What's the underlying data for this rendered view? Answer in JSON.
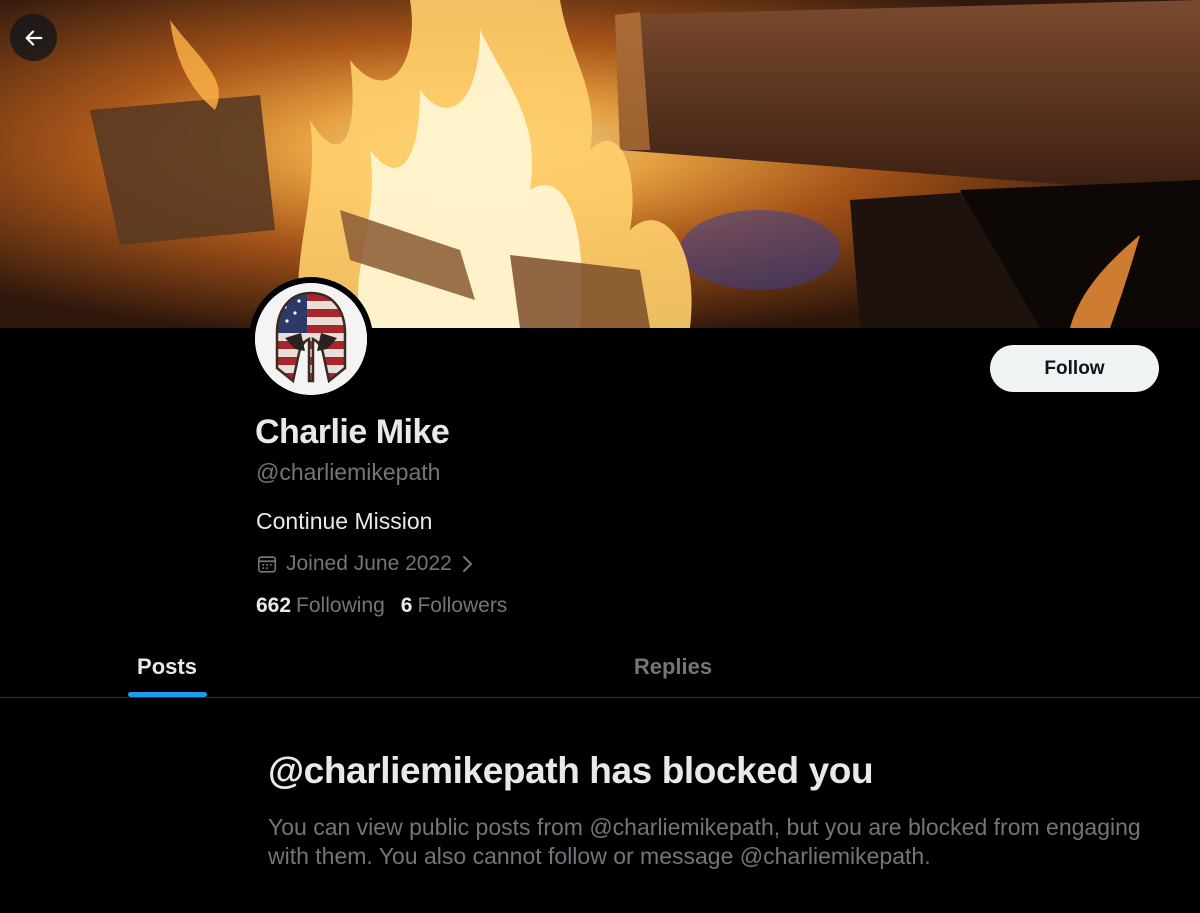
{
  "header": {
    "back_icon": "arrow-left-icon",
    "banner_description_icon": "campfire-photo"
  },
  "profile": {
    "display_name": "Charlie Mike",
    "handle": "@charliemikepath",
    "bio": "Continue Mission",
    "joined": "Joined June 2022",
    "following_count": "662",
    "following_label": "Following",
    "followers_count": "6",
    "followers_label": "Followers"
  },
  "actions": {
    "follow_label": "Follow"
  },
  "tabs": [
    {
      "label": "Posts",
      "active": true
    },
    {
      "label": "Replies",
      "active": false
    }
  ],
  "blocked": {
    "title": "@charliemikepath has blocked you",
    "body": "You can view public posts from @charliemikepath, but you are blocked from engaging with them. You also cannot follow or message @charliemikepath."
  },
  "colors": {
    "background": "#000000",
    "primary_text": "#e7e9ea",
    "secondary_text": "#71767b",
    "accent": "#1d9bf0",
    "follow_button_bg": "#eff3f4",
    "divider": "#2f3336"
  }
}
